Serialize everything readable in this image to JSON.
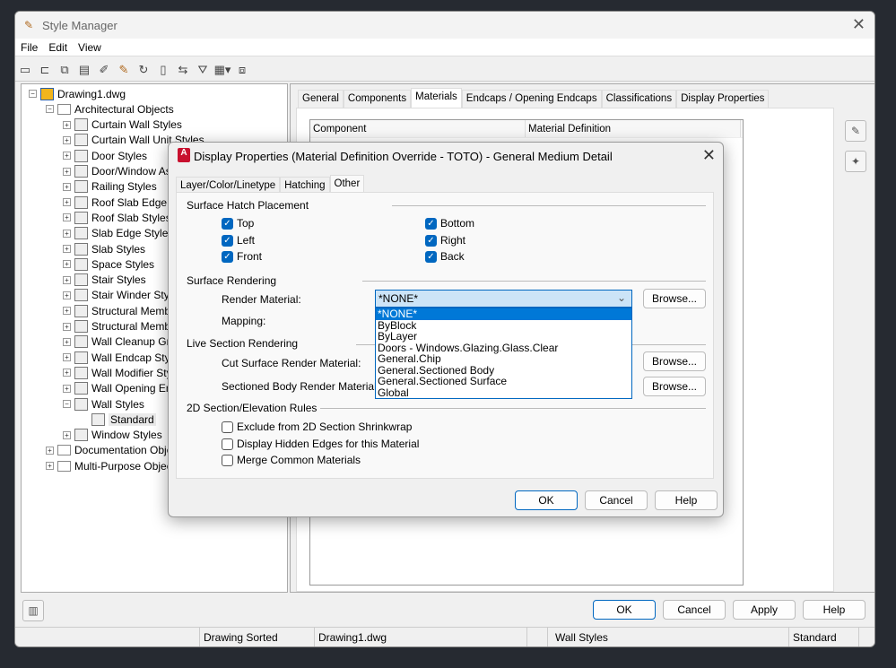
{
  "window": {
    "title": "Style Manager",
    "close": "✕"
  },
  "menu": [
    "File",
    "Edit",
    "View"
  ],
  "toolbar_icons": [
    "new-icon",
    "open-icon",
    "copy-icon",
    "paste-icon",
    "purge-icon",
    "edit-style-icon",
    "sync-icon",
    "import-icon",
    "compare-icon",
    "filter-icon",
    "view-icon",
    "toggle-icon"
  ],
  "tree": [
    {
      "label": "Drawing1.dwg",
      "level": 0,
      "expand": "−",
      "icon": "drawing-icon"
    },
    {
      "label": "Architectural Objects",
      "level": 1,
      "expand": "−",
      "icon": "folder-icon"
    },
    {
      "label": "Curtain Wall Styles",
      "level": 2,
      "expand": "+"
    },
    {
      "label": "Curtain Wall Unit Styles",
      "level": 2,
      "expand": "+"
    },
    {
      "label": "Door Styles",
      "level": 2,
      "expand": "+"
    },
    {
      "label": "Door/Window Ass",
      "level": 2,
      "expand": "+"
    },
    {
      "label": "Railing Styles",
      "level": 2,
      "expand": "+"
    },
    {
      "label": "Roof Slab Edge Sty",
      "level": 2,
      "expand": "+"
    },
    {
      "label": "Roof Slab Styles",
      "level": 2,
      "expand": "+"
    },
    {
      "label": "Slab Edge Styles",
      "level": 2,
      "expand": "+"
    },
    {
      "label": "Slab Styles",
      "level": 2,
      "expand": "+"
    },
    {
      "label": "Space Styles",
      "level": 2,
      "expand": "+"
    },
    {
      "label": "Stair Styles",
      "level": 2,
      "expand": "+"
    },
    {
      "label": "Stair Winder Styles",
      "level": 2,
      "expand": "+"
    },
    {
      "label": "Structural Membe",
      "level": 2,
      "expand": "+"
    },
    {
      "label": "Structural Membe",
      "level": 2,
      "expand": "+"
    },
    {
      "label": "Wall Cleanup Grou",
      "level": 2,
      "expand": "+"
    },
    {
      "label": "Wall Endcap Styles",
      "level": 2,
      "expand": "+"
    },
    {
      "label": "Wall Modifier Style",
      "level": 2,
      "expand": "+"
    },
    {
      "label": "Wall Opening End",
      "level": 2,
      "expand": "+"
    },
    {
      "label": "Wall Styles",
      "level": 2,
      "expand": "−"
    },
    {
      "label": "Standard",
      "level": 3,
      "expand": "",
      "selected": true
    },
    {
      "label": "Window Styles",
      "level": 2,
      "expand": "+"
    },
    {
      "label": "Documentation Objec",
      "level": 1,
      "expand": "+",
      "icon": "folder-icon"
    },
    {
      "label": "Multi-Purpose Object",
      "level": 1,
      "expand": "+",
      "icon": "folder-icon"
    }
  ],
  "style_tabs": [
    {
      "label": "General"
    },
    {
      "label": "Components"
    },
    {
      "label": "Materials",
      "active": true
    },
    {
      "label": "Endcaps / Opening Endcaps"
    },
    {
      "label": "Classifications"
    },
    {
      "label": "Display Properties"
    }
  ],
  "grid": {
    "headers": [
      "Component",
      "Material Definition"
    ]
  },
  "main_buttons": {
    "ok": "OK",
    "cancel": "Cancel",
    "apply": "Apply",
    "help": "Help"
  },
  "status": {
    "sort": "Drawing Sorted",
    "file": "Drawing1.dwg",
    "category": "Wall Styles",
    "style": "Standard"
  },
  "dialog": {
    "title": "Display Properties (Material Definition Override - TOTO) - General Medium Detail",
    "close": "✕",
    "logo": "A",
    "tabs": [
      {
        "label": "Layer/Color/Linetype"
      },
      {
        "label": "Hatching"
      },
      {
        "label": "Other",
        "active": true
      }
    ],
    "hatch_section": "Surface Hatch Placement",
    "hatch": {
      "top": "Top",
      "left": "Left",
      "front": "Front",
      "bottom": "Bottom",
      "right": "Right",
      "back": "Back"
    },
    "rendering_section": "Surface Rendering",
    "render_material_label": "Render Material:",
    "render_material_value": "*NONE*",
    "mapping_label": "Mapping:",
    "dropdown_options": [
      "*NONE*",
      "ByBlock",
      "ByLayer",
      "Doors - Windows.Glazing.Glass.Clear",
      "General.Chip",
      "General.Sectioned Body",
      "General.Sectioned Surface",
      "Global"
    ],
    "browse": "Browse...",
    "live_section": "Live Section Rendering",
    "cut_surface_label": "Cut Surface Render Material:",
    "sectioned_body_label": "Sectioned Body Render Material:",
    "rules_section": "2D Section/Elevation Rules",
    "rules": {
      "exclude": "Exclude from 2D Section Shrinkwrap",
      "hidden": "Display Hidden Edges for this Material",
      "merge": "Merge Common Materials"
    },
    "ok": "OK",
    "cancel": "Cancel",
    "help": "Help"
  },
  "colors": {
    "accent": "#0067c0",
    "selection": "#0078d7",
    "combo_bg": "#cce4f7"
  }
}
